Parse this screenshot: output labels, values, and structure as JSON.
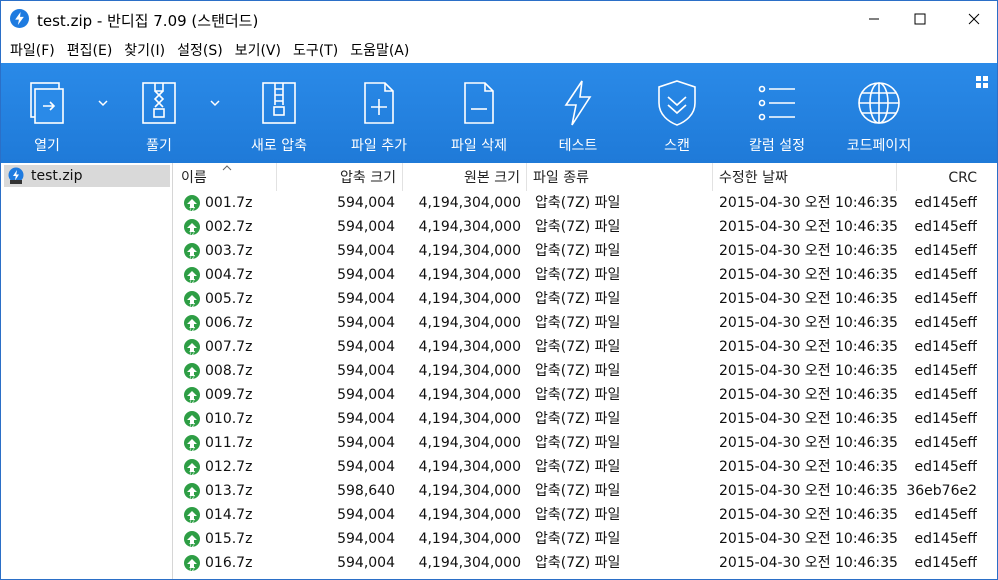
{
  "window": {
    "title": "test.zip - 반디집 7.09 (스탠더드)"
  },
  "menu": [
    "파일(F)",
    "편집(E)",
    "찾기(I)",
    "설정(S)",
    "보기(V)",
    "도구(T)",
    "도움말(A)"
  ],
  "toolbar": {
    "open": "열기",
    "extract": "풀기",
    "new_archive": "새로 압축",
    "add_file": "파일 추가",
    "delete_file": "파일 삭제",
    "test": "테스트",
    "scan": "스캔",
    "columns": "칼럼 설정",
    "codepage": "코드페이지"
  },
  "tree": {
    "root": "test.zip"
  },
  "columns": {
    "name": "이름",
    "packed": "압축 크기",
    "original": "원본 크기",
    "type": "파일 종류",
    "modified": "수정한 날짜",
    "crc": "CRC"
  },
  "files": [
    {
      "name": "001.7z",
      "packed": "594,004",
      "original": "4,194,304,000",
      "type": "압축(7Z) 파일",
      "modified": "2015-04-30 오전 10:46:35",
      "crc": "ed145eff"
    },
    {
      "name": "002.7z",
      "packed": "594,004",
      "original": "4,194,304,000",
      "type": "압축(7Z) 파일",
      "modified": "2015-04-30 오전 10:46:35",
      "crc": "ed145eff"
    },
    {
      "name": "003.7z",
      "packed": "594,004",
      "original": "4,194,304,000",
      "type": "압축(7Z) 파일",
      "modified": "2015-04-30 오전 10:46:35",
      "crc": "ed145eff"
    },
    {
      "name": "004.7z",
      "packed": "594,004",
      "original": "4,194,304,000",
      "type": "압축(7Z) 파일",
      "modified": "2015-04-30 오전 10:46:35",
      "crc": "ed145eff"
    },
    {
      "name": "005.7z",
      "packed": "594,004",
      "original": "4,194,304,000",
      "type": "압축(7Z) 파일",
      "modified": "2015-04-30 오전 10:46:35",
      "crc": "ed145eff"
    },
    {
      "name": "006.7z",
      "packed": "594,004",
      "original": "4,194,304,000",
      "type": "압축(7Z) 파일",
      "modified": "2015-04-30 오전 10:46:35",
      "crc": "ed145eff"
    },
    {
      "name": "007.7z",
      "packed": "594,004",
      "original": "4,194,304,000",
      "type": "압축(7Z) 파일",
      "modified": "2015-04-30 오전 10:46:35",
      "crc": "ed145eff"
    },
    {
      "name": "008.7z",
      "packed": "594,004",
      "original": "4,194,304,000",
      "type": "압축(7Z) 파일",
      "modified": "2015-04-30 오전 10:46:35",
      "crc": "ed145eff"
    },
    {
      "name": "009.7z",
      "packed": "594,004",
      "original": "4,194,304,000",
      "type": "압축(7Z) 파일",
      "modified": "2015-04-30 오전 10:46:35",
      "crc": "ed145eff"
    },
    {
      "name": "010.7z",
      "packed": "594,004",
      "original": "4,194,304,000",
      "type": "압축(7Z) 파일",
      "modified": "2015-04-30 오전 10:46:35",
      "crc": "ed145eff"
    },
    {
      "name": "011.7z",
      "packed": "594,004",
      "original": "4,194,304,000",
      "type": "압축(7Z) 파일",
      "modified": "2015-04-30 오전 10:46:35",
      "crc": "ed145eff"
    },
    {
      "name": "012.7z",
      "packed": "594,004",
      "original": "4,194,304,000",
      "type": "압축(7Z) 파일",
      "modified": "2015-04-30 오전 10:46:35",
      "crc": "ed145eff"
    },
    {
      "name": "013.7z",
      "packed": "598,640",
      "original": "4,194,304,000",
      "type": "압축(7Z) 파일",
      "modified": "2015-04-30 오전 10:46:35",
      "crc": "36eb76e2"
    },
    {
      "name": "014.7z",
      "packed": "594,004",
      "original": "4,194,304,000",
      "type": "압축(7Z) 파일",
      "modified": "2015-04-30 오전 10:46:35",
      "crc": "ed145eff"
    },
    {
      "name": "015.7z",
      "packed": "594,004",
      "original": "4,194,304,000",
      "type": "압축(7Z) 파일",
      "modified": "2015-04-30 오전 10:46:35",
      "crc": "ed145eff"
    },
    {
      "name": "016.7z",
      "packed": "594,004",
      "original": "4,194,304,000",
      "type": "압축(7Z) 파일",
      "modified": "2015-04-30 오전 10:46:35",
      "crc": "ed145eff"
    }
  ],
  "colors": {
    "toolbar": "#2a8ae8",
    "tree_selected": "#d9d9d9",
    "file_icon": "#2e9e45"
  }
}
